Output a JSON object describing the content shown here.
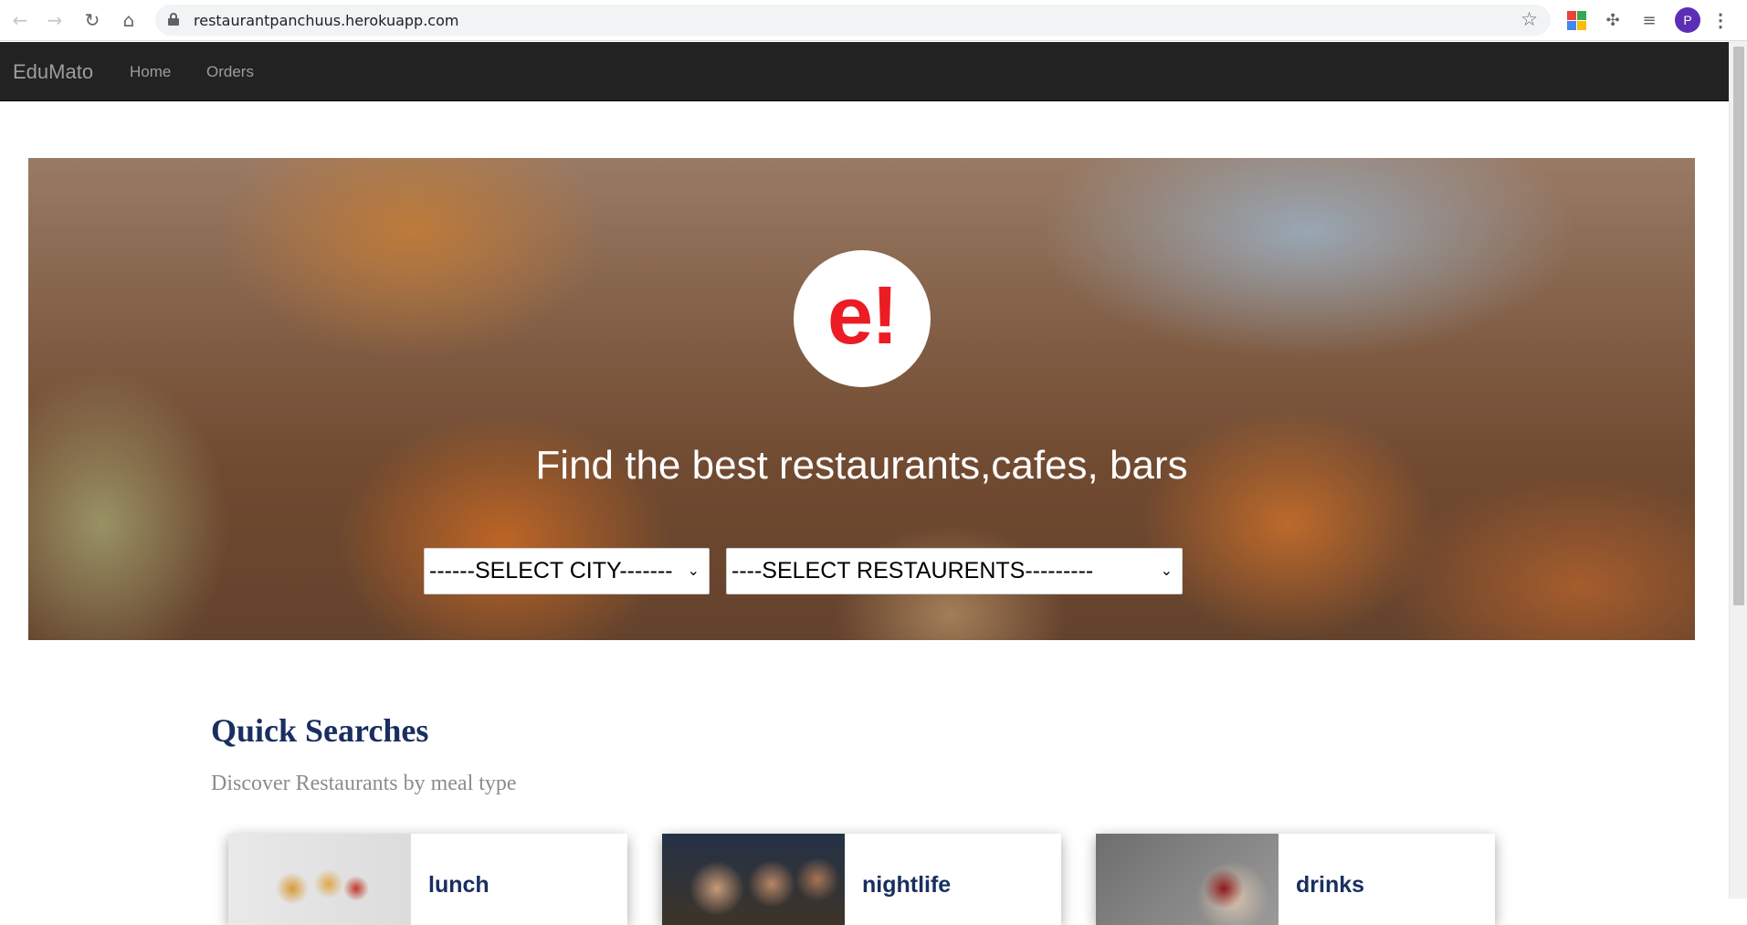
{
  "browser": {
    "url": "restaurantpanchuus.herokuapp.com",
    "profile_initial": "P",
    "icons": [
      "back-icon",
      "forward-icon",
      "reload-icon",
      "home-icon",
      "lock-icon",
      "star-icon",
      "extension-grid-icon",
      "puzzle-icon",
      "media-icon",
      "kebab-menu-icon"
    ]
  },
  "navbar": {
    "brand": "EduMato",
    "links": [
      "Home",
      "Orders"
    ]
  },
  "hero": {
    "logo": "e!",
    "title": "Find the best restaurants,cafes, bars",
    "city_select": "------SELECT CITY-------",
    "restaurant_select": "----SELECT RESTAURENTS---------"
  },
  "quick_searches": {
    "title": "Quick Searches",
    "subtitle": "Discover Restaurants by meal type",
    "cards": [
      {
        "label": "lunch"
      },
      {
        "label": "nightlife"
      },
      {
        "label": "drinks"
      }
    ]
  },
  "colors": {
    "navbar_bg": "#222222",
    "brand_text": "#9d9d9d",
    "logo_red": "#eb1c24",
    "heading_navy": "#192f60",
    "profile_purple": "#5b2fb5"
  }
}
